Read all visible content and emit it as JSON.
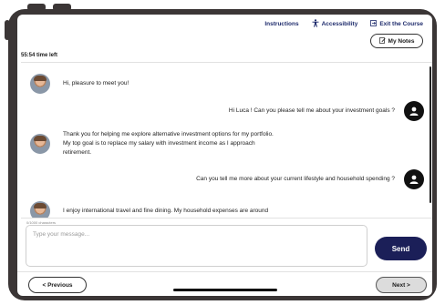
{
  "nav": {
    "instructions": "Instructions",
    "accessibility": "Accessibility",
    "exit": "Exit the Course"
  },
  "notes_label": "My Notes",
  "timer": "55:54 time left",
  "messages": [
    {
      "sender": "persona",
      "text": "Hi, pleasure to meet you!"
    },
    {
      "sender": "user",
      "text": "Hi Luca ! Can you please tell me about your investment goals ?"
    },
    {
      "sender": "persona",
      "text": "Thank you for helping me explore alternative investment options for my portfolio.\nMy top goal is to replace my salary with investment income as I approach\nretirement."
    },
    {
      "sender": "user",
      "text": "Can you tell me more about your current lifestyle and household spending ?"
    },
    {
      "sender": "persona",
      "text": "I enjoy international travel and fine dining. My household expenses are around"
    }
  ],
  "composer": {
    "char_count": "0/1000 characters",
    "placeholder": "Type your message...",
    "send_label": "Send"
  },
  "footer": {
    "previous_label": "< Previous",
    "next_label": "Next >"
  },
  "colors": {
    "accent": "#1b1f58",
    "nav_text": "#1d2a6b",
    "frame": "#3b3636"
  }
}
